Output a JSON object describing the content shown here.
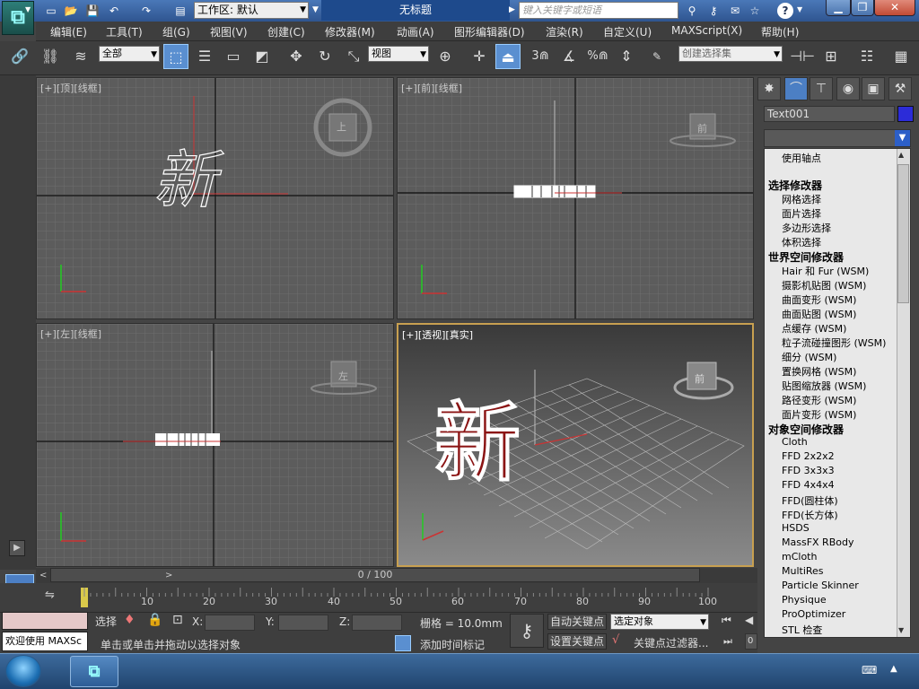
{
  "titlebar": {
    "workspace_label": "工作区: 默认",
    "document_title": "无标题",
    "search_placeholder": "键入关键字或短语",
    "help_label": "?"
  },
  "menus": [
    "编辑(E)",
    "工具(T)",
    "组(G)",
    "视图(V)",
    "创建(C)",
    "修改器(M)",
    "动画(A)",
    "图形编辑器(D)",
    "渲染(R)",
    "自定义(U)",
    "MAXScript(X)",
    "帮助(H)"
  ],
  "toolbar": {
    "filter_value": "全部",
    "ref_coord_value": "视图",
    "selection_set_placeholder": "创建选择集",
    "snap_3": "3",
    "snap_percent": "%"
  },
  "viewports": {
    "top": {
      "plus": "[+]",
      "name": "[顶]",
      "mode": "[线框]",
      "cube_label": "上"
    },
    "front": {
      "plus": "[+]",
      "name": "[前]",
      "mode": "[线框]",
      "cube_label": "前"
    },
    "left": {
      "plus": "[+]",
      "name": "[左]",
      "mode": "[线框]",
      "cube_label": "左"
    },
    "perspective": {
      "plus": "[+]",
      "name": "[透视]",
      "mode": "[真实]",
      "cube_label": "前"
    },
    "text_object": "新"
  },
  "command_panel": {
    "object_name": "Text001",
    "object_color": "#2c2cd8",
    "modifier_list": [
      {
        "kind": "item",
        "label": "使用轴点"
      },
      {
        "kind": "header",
        "label": "选择修改器"
      },
      {
        "kind": "item",
        "label": "网格选择"
      },
      {
        "kind": "item",
        "label": "面片选择"
      },
      {
        "kind": "item",
        "label": "多边形选择"
      },
      {
        "kind": "item",
        "label": "体积选择"
      },
      {
        "kind": "header",
        "label": "世界空间修改器"
      },
      {
        "kind": "item",
        "label": "Hair 和 Fur (WSM)"
      },
      {
        "kind": "item",
        "label": "摄影机贴图 (WSM)"
      },
      {
        "kind": "item",
        "label": "曲面变形 (WSM)"
      },
      {
        "kind": "item",
        "label": "曲面贴图 (WSM)"
      },
      {
        "kind": "item",
        "label": "点缓存 (WSM)"
      },
      {
        "kind": "item",
        "label": "粒子流碰撞图形 (WSM)"
      },
      {
        "kind": "item",
        "label": "细分 (WSM)"
      },
      {
        "kind": "item",
        "label": "置换网格 (WSM)"
      },
      {
        "kind": "item",
        "label": "贴图缩放器 (WSM)"
      },
      {
        "kind": "item",
        "label": "路径变形 (WSM)"
      },
      {
        "kind": "item",
        "label": "面片变形 (WSM)"
      },
      {
        "kind": "header",
        "label": "对象空间修改器"
      },
      {
        "kind": "item",
        "label": "Cloth"
      },
      {
        "kind": "item",
        "label": "FFD 2x2x2"
      },
      {
        "kind": "item",
        "label": "FFD 3x3x3"
      },
      {
        "kind": "item",
        "label": "FFD 4x4x4"
      },
      {
        "kind": "item",
        "label": "FFD(圆柱体)"
      },
      {
        "kind": "item",
        "label": "FFD(长方体)"
      },
      {
        "kind": "item",
        "label": "HSDS"
      },
      {
        "kind": "item",
        "label": "MassFX RBody"
      },
      {
        "kind": "item",
        "label": "mCloth"
      },
      {
        "kind": "item",
        "label": "MultiRes"
      },
      {
        "kind": "item",
        "label": "Particle Skinner"
      },
      {
        "kind": "item",
        "label": "Physique"
      },
      {
        "kind": "item",
        "label": "ProOptimizer"
      },
      {
        "kind": "item",
        "label": "STL 检查"
      }
    ]
  },
  "timeline": {
    "frame_display": "0 / 100",
    "ticks": [
      "10",
      "20",
      "30",
      "40",
      "50",
      "60",
      "70",
      "80",
      "90",
      "100"
    ]
  },
  "status": {
    "selection_label": "选择",
    "x_label": "X:",
    "y_label": "Y:",
    "z_label": "Z:",
    "grid_label": "栅格 = 10.0mm",
    "prompt": "单击或单击并拖动以选择对象",
    "add_time_tag": "添加时间标记",
    "auto_key": "自动关键点",
    "set_key": "设置关键点",
    "selected_object": "选定对象",
    "key_filters": "关键点过滤器...",
    "maxscript_welcome": "欢迎使用 MAXSc",
    "frame_value": "0"
  }
}
